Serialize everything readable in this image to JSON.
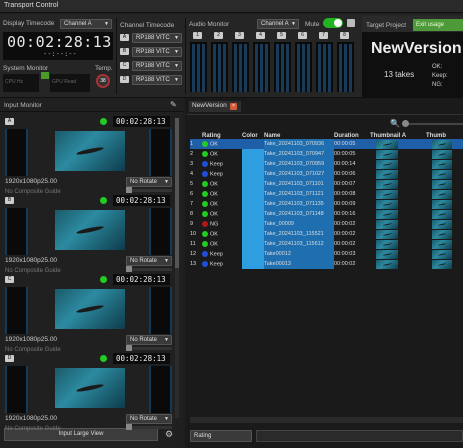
{
  "window": {
    "title": "Transport Control"
  },
  "display_timecode": {
    "label": "Display Timecode",
    "channel": "Channel A",
    "value": "00:02:28:13",
    "sub": "--:--:--"
  },
  "system_monitor": {
    "label": "System Monitor",
    "temp_label": "Temp.",
    "temp_value": "38",
    "cpu_label": "CPU Hz",
    "gpu_label": "GPU Read"
  },
  "channel_timecode": {
    "label": "Channel Timecode",
    "rows": [
      {
        "tag": "A",
        "value": "RP188 VITC"
      },
      {
        "tag": "B",
        "value": "RP188 VITC"
      },
      {
        "tag": "C",
        "value": "RP188 VITC"
      },
      {
        "tag": "D",
        "value": "RP188 VITC"
      }
    ]
  },
  "audio_monitor": {
    "label": "Audio Monitor",
    "channel": "Channel A",
    "mute_label": "Mute",
    "channels": [
      "1",
      "2",
      "3",
      "4",
      "5",
      "6",
      "7",
      "8"
    ]
  },
  "target_project": {
    "label": "Target Project",
    "button": "Exit usage",
    "name": "NewVersion",
    "takes": "13 takes",
    "ok_label": "OK:",
    "keep_label": "Keep:",
    "ng_label": "NG:"
  },
  "input_monitor": {
    "label": "Input Monitor",
    "monitors": [
      {
        "tag": "A",
        "timecode": "00:02:28:13",
        "format": "1920x1080p25.00",
        "rotate": "No Rotate",
        "guide": "No Composite Guide"
      },
      {
        "tag": "B",
        "timecode": "00:02:28:13",
        "format": "1920x1080p25.00",
        "rotate": "No Rotate",
        "guide": "No Composite Guide"
      },
      {
        "tag": "C",
        "timecode": "00:02:28:13",
        "format": "1920x1080p25.00",
        "rotate": "No Rotate",
        "guide": "No Composite Guide"
      },
      {
        "tag": "D",
        "timecode": "00:02:28:13",
        "format": "1920x1080p25.00",
        "rotate": "No Rotate",
        "guide": "No Composite Guide"
      }
    ],
    "large_view_button": "Input Large View"
  },
  "project_tab": {
    "label": "NewVersion"
  },
  "takes_table": {
    "columns": [
      "Rating",
      "Color",
      "Name",
      "Duration",
      "Thumbnail A",
      "Thumb"
    ],
    "rows": [
      {
        "n": "1",
        "rating": "OK",
        "rating_color": "#22cc22",
        "name": "Take_20241103_070936",
        "duration": "00:00:05",
        "selected": true
      },
      {
        "n": "2",
        "rating": "OK",
        "rating_color": "#22cc22",
        "name": "Take_20241103_070947",
        "duration": "00:00:05",
        "selected": false
      },
      {
        "n": "3",
        "rating": "Keep",
        "rating_color": "#1e4fd6",
        "name": "Take_20241103_070959",
        "duration": "00:00:14",
        "selected": false
      },
      {
        "n": "4",
        "rating": "Keep",
        "rating_color": "#1e4fd6",
        "name": "Take_20241103_071027",
        "duration": "00:00:06",
        "selected": false
      },
      {
        "n": "5",
        "rating": "OK",
        "rating_color": "#22cc22",
        "name": "Take_20241103_071101",
        "duration": "00:00:07",
        "selected": false
      },
      {
        "n": "6",
        "rating": "OK",
        "rating_color": "#22cc22",
        "name": "Take_20241103_071121",
        "duration": "00:00:08",
        "selected": false
      },
      {
        "n": "7",
        "rating": "OK",
        "rating_color": "#22cc22",
        "name": "Take_20241103_071135",
        "duration": "00:00:09",
        "selected": false
      },
      {
        "n": "8",
        "rating": "OK",
        "rating_color": "#22cc22",
        "name": "Take_20241103_071148",
        "duration": "00:00:16",
        "selected": false
      },
      {
        "n": "9",
        "rating": "NG",
        "rating_color": "#b01818",
        "name": "Take_00009",
        "duration": "00:00:02",
        "selected": false
      },
      {
        "n": "10",
        "rating": "OK",
        "rating_color": "#22cc22",
        "name": "Take_20241103_115521",
        "duration": "00:00:02",
        "selected": false
      },
      {
        "n": "11",
        "rating": "OK",
        "rating_color": "#22cc22",
        "name": "Take_20241103_115612",
        "duration": "00:00:02",
        "selected": false
      },
      {
        "n": "12",
        "rating": "Keep",
        "rating_color": "#1e4fd6",
        "name": "Take00012",
        "duration": "00:00:03",
        "selected": false
      },
      {
        "n": "13",
        "rating": "Keep",
        "rating_color": "#1e4fd6",
        "name": "Take00013",
        "duration": "00:00:02",
        "selected": false
      }
    ]
  },
  "footer": {
    "sort_field": "Rating"
  },
  "colors": {
    "accent": "#1f5fa8",
    "ok": "#22cc22",
    "keep": "#1e4fd6",
    "ng": "#b01818",
    "tag_color": "#2e9ee0"
  }
}
